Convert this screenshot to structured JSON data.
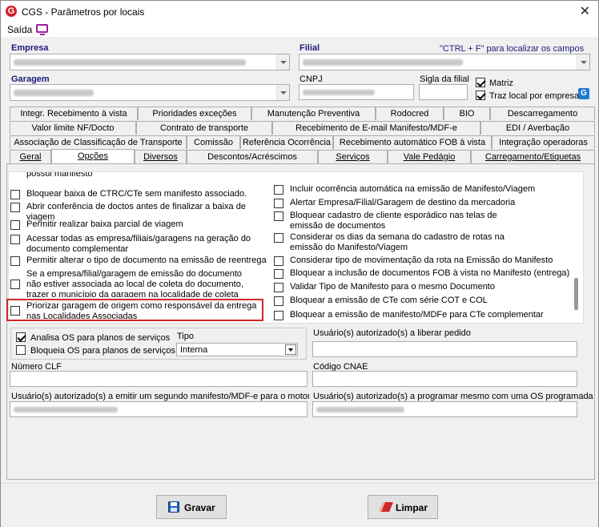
{
  "window": {
    "title": "CGS - Parâmetros por locais",
    "close": "✕"
  },
  "menu": {
    "saida": "Saída"
  },
  "header": {
    "empresa_label": "Empresa",
    "filial_label": "Filial",
    "hint": "\"CTRL + F\" para localizar os campos",
    "garagem_label": "Garagem",
    "cnpj_label": "CNPJ",
    "sigla_label": "Sigla da filial",
    "matriz_label": "Matriz",
    "traz_local_label": "Traz local por empresa",
    "matriz_checked": true,
    "traz_local_checked": true
  },
  "tabs": {
    "row1": [
      "Integr. Recebimento à vista",
      "Prioridades exceções",
      "Manutenção Preventiva",
      "Rodocred",
      "BIO",
      "Descarregamento"
    ],
    "row2": [
      "Valor limite NF/Docto",
      "Contrato de transporte",
      "Recebimento de E-mail Manifesto/MDF-e",
      "EDI / Averbação"
    ],
    "row3": [
      "Associação de Classificação de Transporte",
      "Comissão",
      "Referência Ocorrência",
      "Recebimento automático FOB à vista",
      "Integração operadoras"
    ],
    "row4": [
      "Geral",
      "Opções",
      "Diversos",
      "Descontos/Acréscimos",
      "Serviços",
      "Vale Pedágio",
      "Carregamento/Etiquetas"
    ],
    "active": "Opções"
  },
  "options_left": [
    {
      "label": "possui manifesto",
      "partial": true
    },
    {
      "label": "Bloquear baixa de CTRC/CTe sem manifesto associado."
    },
    {
      "label": "Abrir conferência de doctos antes de finalizar a baixa de viagem"
    },
    {
      "label": "Permitir realizar baixa parcial de viagem"
    },
    {
      "label": "Acessar todas as empresa/filiais/garagens na geração do documento complementar"
    },
    {
      "label": "Permitir alterar o tipo de documento na emissão de reentrega"
    },
    {
      "label": "Se a empresa/filial/garagem de emissão do documento não estiver associada ao local de coleta do documento, trazer o município da garagem na localidade de coleta"
    },
    {
      "label": "Priorizar garagem de origem como responsável da entrega nas Localidades Associadas"
    }
  ],
  "options_right": [
    {
      "label": "Incluir ocorrência automática na emissão de Manifesto/Viagem"
    },
    {
      "label": "Alertar Empresa/Filial/Garagem de destino da mercadoria"
    },
    {
      "label": "Bloquear cadastro de cliente esporádico nas telas de emissão de documentos"
    },
    {
      "label": "Considerar os dias da semana do cadastro de rotas na emissão do Manifesto/Viagem"
    },
    {
      "label": "Considerar tipo de movimentação da rota na Emissão do Manifesto"
    },
    {
      "label": "Bloquear a inclusão de documentos FOB à vista no Manifesto (entrega)"
    },
    {
      "label": "Validar Tipo de Manifesto para o mesmo Documento"
    },
    {
      "label": "Bloquear a emissão de CTe com série COT e COL"
    },
    {
      "label": "Bloquear a emissão de manifesto/MDFe para CTe complementar"
    }
  ],
  "services": {
    "analisa_os_label": "Analisa OS para planos de serviços",
    "analisa_os_checked": true,
    "bloqueia_os_label": "Bloqueia OS para planos de serviços",
    "bloqueia_os_checked": false,
    "tipo_label": "Tipo",
    "tipo_value": "Interna"
  },
  "fields": {
    "liberar_pedido_label": "Usuário(s) autorizado(s) a liberar pedido",
    "numero_clf_label": "Número CLF",
    "codigo_cnae_label": "Código CNAE",
    "segundo_manifesto_label": "Usuário(s) autorizado(s) a emitir um segundo manifesto/MDF-e para o motorista",
    "programar_os_label": "Usuário(s) autorizado(s) a programar mesmo com uma OS programada"
  },
  "buttons": {
    "gravar": "Gravar",
    "limpar": "Limpar"
  },
  "colors": {
    "label_blue": "#1b1b7a",
    "highlight": "#d02828",
    "logo": "#d0202a"
  }
}
